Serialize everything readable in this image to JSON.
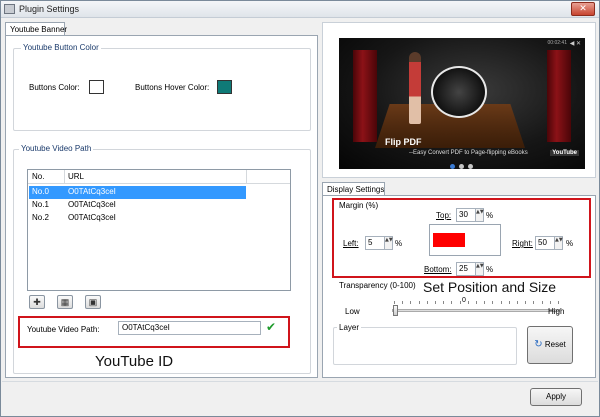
{
  "window": {
    "title": "Plugin Settings",
    "close_symbol": "✕"
  },
  "left": {
    "tab_label": "Youtube Banner",
    "button_color_group": {
      "label": "Youtube Button Color",
      "buttons_color_label": "Buttons Color:",
      "buttons_color": "#ffffff",
      "hover_color_label": "Buttons Hover Color:",
      "hover_color": "#0f7a77"
    },
    "video_path_group": {
      "label": "Youtube Video Path",
      "columns": [
        "No.",
        "URL"
      ],
      "rows": [
        {
          "no": "No.0",
          "url": "O0TAtCq3ceI",
          "selected": true
        },
        {
          "no": "No.1",
          "url": "O0TAtCq3ceI",
          "selected": false
        },
        {
          "no": "No.2",
          "url": "O0TAtCq3ceI",
          "selected": false
        }
      ],
      "tools": {
        "add_symbol": "✚",
        "delete_symbol": "▦",
        "save_symbol": "▣"
      },
      "field_label": "Youtube Video Path:",
      "field_value": "O0TAtCq3ceI",
      "confirm_symbol": "✔"
    },
    "annotation": "YouTube ID"
  },
  "right": {
    "preview": {
      "title": "Flip PDF",
      "subtitle": "--Easy Convert PDF to Page-flipping eBooks",
      "brand": "YouTube",
      "time": "00:02:41",
      "volume_symbol": "◀ ✕"
    },
    "tab_label": "Display Settings",
    "margin": {
      "label": "Margin (%)",
      "top_label": "Top:",
      "top": "30",
      "left_label": "Left:",
      "left": "5",
      "right_label": "Right:",
      "right": "50",
      "bottom_label": "Bottom:",
      "bottom": "25",
      "percent": "%",
      "spin_symbols": "▲▼",
      "preview_color": "#ff0000"
    },
    "annotation": "Set Position and Size",
    "transparency": {
      "label": "Transparency (0-100)",
      "value": "0",
      "value_fraction": 0,
      "low_label": "Low",
      "high_label": "High"
    },
    "layer_label": "Layer",
    "reset_label": "Reset",
    "reset_symbol": "↻"
  },
  "footer": {
    "apply_label": "Apply"
  }
}
